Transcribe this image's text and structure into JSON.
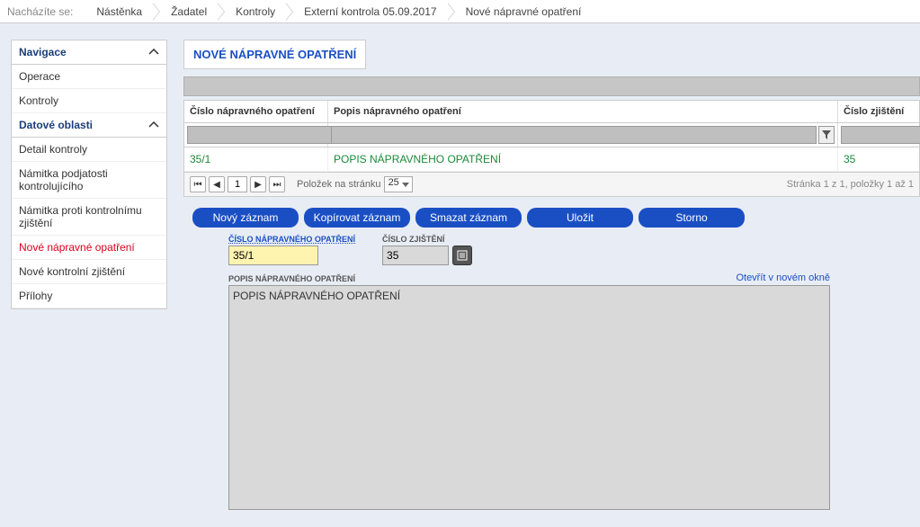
{
  "breadcrumb": {
    "label": "Nacházíte se:",
    "items": [
      "Nástěnka",
      "Žadatel",
      "Kontroly",
      "Externí kontrola 05.09.2017",
      "Nové nápravné opatření"
    ]
  },
  "sidebar": {
    "nav_header": "Navigace",
    "nav_items": [
      "Operace",
      "Kontroly"
    ],
    "data_header": "Datové oblasti",
    "data_items": [
      {
        "label": "Detail kontroly",
        "active": false
      },
      {
        "label": "Námitka podjatosti kontrolujícího",
        "active": false
      },
      {
        "label": "Námitka proti kontrolnímu zjištění",
        "active": false
      },
      {
        "label": "Nové nápravné opatření",
        "active": true
      },
      {
        "label": "Nové kontrolní zjištění",
        "active": false
      },
      {
        "label": "Přílohy",
        "active": false
      }
    ]
  },
  "page": {
    "title": "NOVÉ NÁPRAVNÉ OPATŘENÍ"
  },
  "table": {
    "headers": {
      "col1": "Číslo nápravného opatření",
      "col2": "Popis nápravného opatření",
      "col3": "Číslo zjištění"
    },
    "row": {
      "c1": "35/1",
      "c2": "POPIS NÁPRAVNÉHO OPATŘENÍ",
      "c3": "35"
    },
    "pager": {
      "page": "1",
      "size_label": "Položek na stránku",
      "size": "25",
      "info": "Stránka 1 z 1, položky 1 až 1"
    }
  },
  "actions": {
    "new": "Nový záznam",
    "copy": "Kopírovat záznam",
    "delete": "Smazat záznam",
    "save": "Uložit",
    "cancel": "Storno"
  },
  "form": {
    "id_label": "ČÍSLO NÁPRAVNÉHO OPATŘENÍ",
    "id_value": "35/1",
    "finding_label": "ČÍSLO ZJIŠTĚNÍ",
    "finding_value": "35",
    "desc_label": "POPIS NÁPRAVNÉHO OPATŘENÍ",
    "desc_value": "POPIS NÁPRAVNÉHO OPATŘENÍ",
    "open_link": "Otevřít v novém okně"
  }
}
